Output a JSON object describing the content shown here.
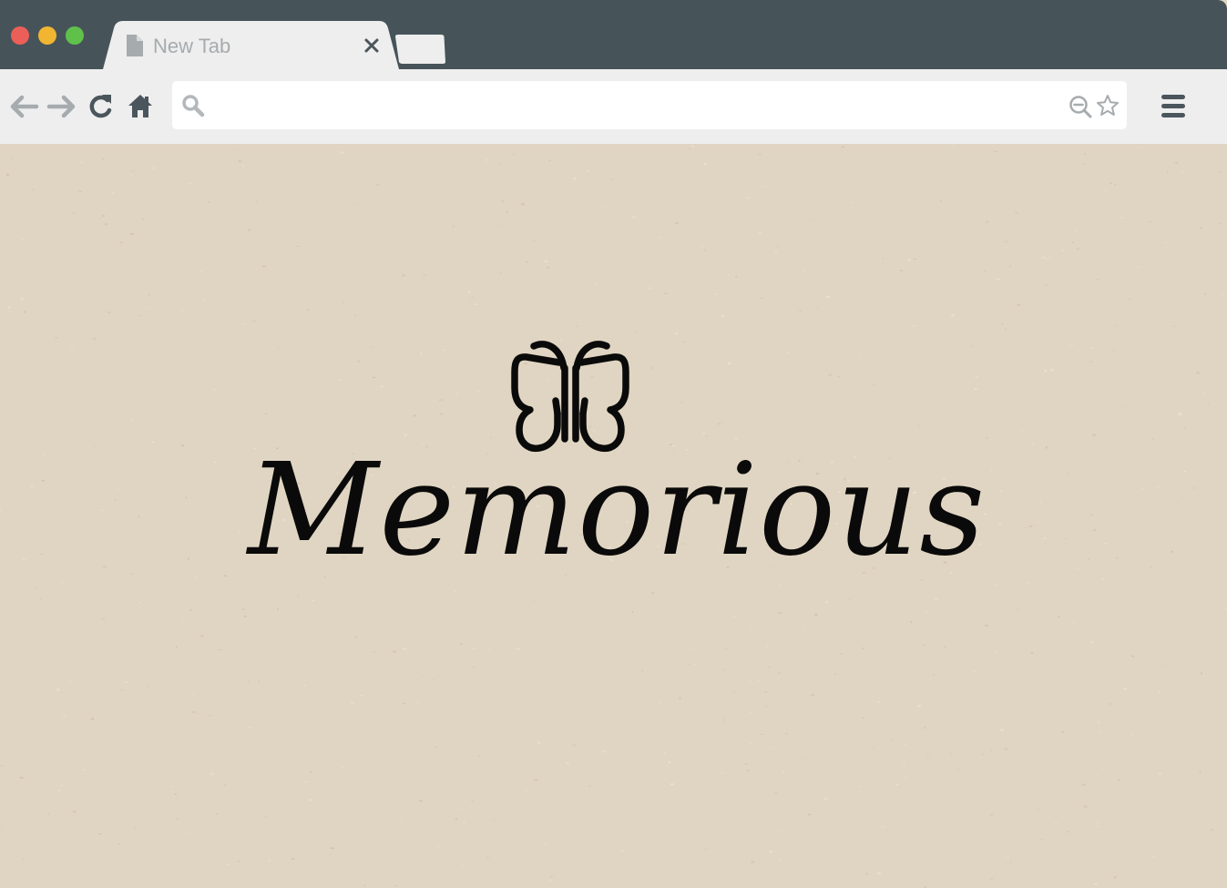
{
  "window": {
    "buttons": {
      "close_color": "#ec5f58",
      "minimize_color": "#f2b531",
      "maximize_color": "#60c14a"
    }
  },
  "tab": {
    "title": "New Tab",
    "icon": "document-icon",
    "close_icon": "close-icon"
  },
  "new_tab": {
    "icon": "new-tab-icon"
  },
  "toolbar": {
    "back_icon": "back-arrow-icon",
    "forward_icon": "forward-arrow-icon",
    "reload_icon": "reload-icon",
    "home_icon": "home-icon",
    "menu_icon": "hamburger-menu-icon"
  },
  "omnibox": {
    "value": "",
    "placeholder": "",
    "search_icon": "search-icon",
    "zoom_icon": "zoom-out-icon",
    "bookmark_icon": "star-icon"
  },
  "page": {
    "logo_icon": "butterfly-icon",
    "brand_name": "Memorious",
    "background_color": "#e0d5c2"
  }
}
